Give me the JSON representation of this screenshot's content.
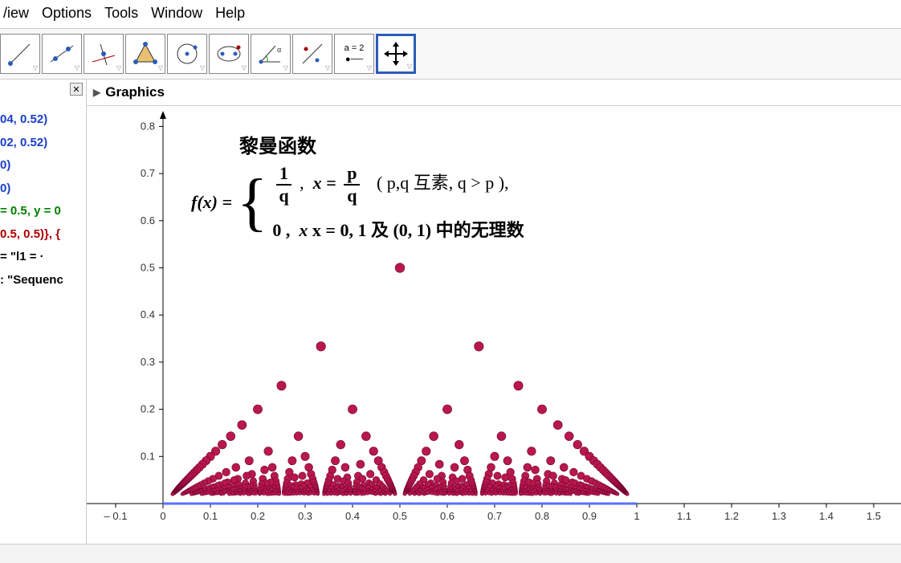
{
  "menu": {
    "items": [
      "/iew",
      "Options",
      "Tools",
      "Window",
      "Help"
    ]
  },
  "toolbar": {
    "tools": [
      {
        "id": "move-tool"
      },
      {
        "id": "line-tool"
      },
      {
        "id": "perpendicular-tool"
      },
      {
        "id": "polygon-tool"
      },
      {
        "id": "circle-tool"
      },
      {
        "id": "ellipse-tool"
      },
      {
        "id": "angle-tool"
      },
      {
        "id": "reflect-tool"
      },
      {
        "id": "slider-tool",
        "label": "a = 2"
      },
      {
        "id": "move-graphics-tool",
        "active": true
      }
    ]
  },
  "sidebar": {
    "items": [
      {
        "text": "04, 0.52)",
        "cls": "blue"
      },
      {
        "text": "02, 0.52)",
        "cls": "blue"
      },
      {
        "text": " 0)",
        "cls": "blue"
      },
      {
        "text": " 0)",
        "cls": "blue"
      },
      {
        "text": "",
        "cls": "black"
      },
      {
        "text": "= 0.5, y = 0",
        "cls": "green"
      },
      {
        "text": "0.5, 0.5)}, {",
        "cls": "red"
      },
      {
        "text": "= \"l1 =  ·",
        "cls": "black"
      },
      {
        "text": ": \"Sequenc",
        "cls": "black"
      }
    ]
  },
  "graphics": {
    "title": "Graphics"
  },
  "formula": {
    "title": "黎曼函数",
    "fx": "f(x) =",
    "case1": {
      "lhs_num": "1",
      "lhs_den": "q",
      "comma": ",",
      "x_eq": "x =",
      "rhs_num": "p",
      "rhs_den": "q",
      "cond": "( p,q 互素, q > p ),"
    },
    "case2": {
      "val": "0 ,",
      "cond": "x = 0, 1 及 (0, 1) 中的无理数"
    }
  },
  "chart_data": {
    "type": "scatter",
    "title": "黎曼函数 (Riemann / Thomae's function)",
    "xlabel": "",
    "ylabel": "",
    "xlim": [
      -0.15,
      1.1
    ],
    "ylim": [
      -0.05,
      0.85
    ],
    "xticks": [
      -0.1,
      0,
      0.1,
      0.2,
      0.3,
      0.4,
      0.5,
      0.6,
      0.7,
      0.8,
      0.9,
      1,
      1.1,
      1.2,
      1.3,
      1.4,
      1.5
    ],
    "yticks": [
      0.1,
      0.2,
      0.3,
      0.4,
      0.5,
      0.6,
      0.7,
      0.8
    ],
    "series_description": "f(p/q)=1/q for coprime p<q, 0 elsewhere; points for q=2..50",
    "q_max": 50,
    "color": "#b8184e",
    "baseline_segment": {
      "x0": 0,
      "x1": 1,
      "y": 0,
      "color": "#5b6fff"
    }
  }
}
